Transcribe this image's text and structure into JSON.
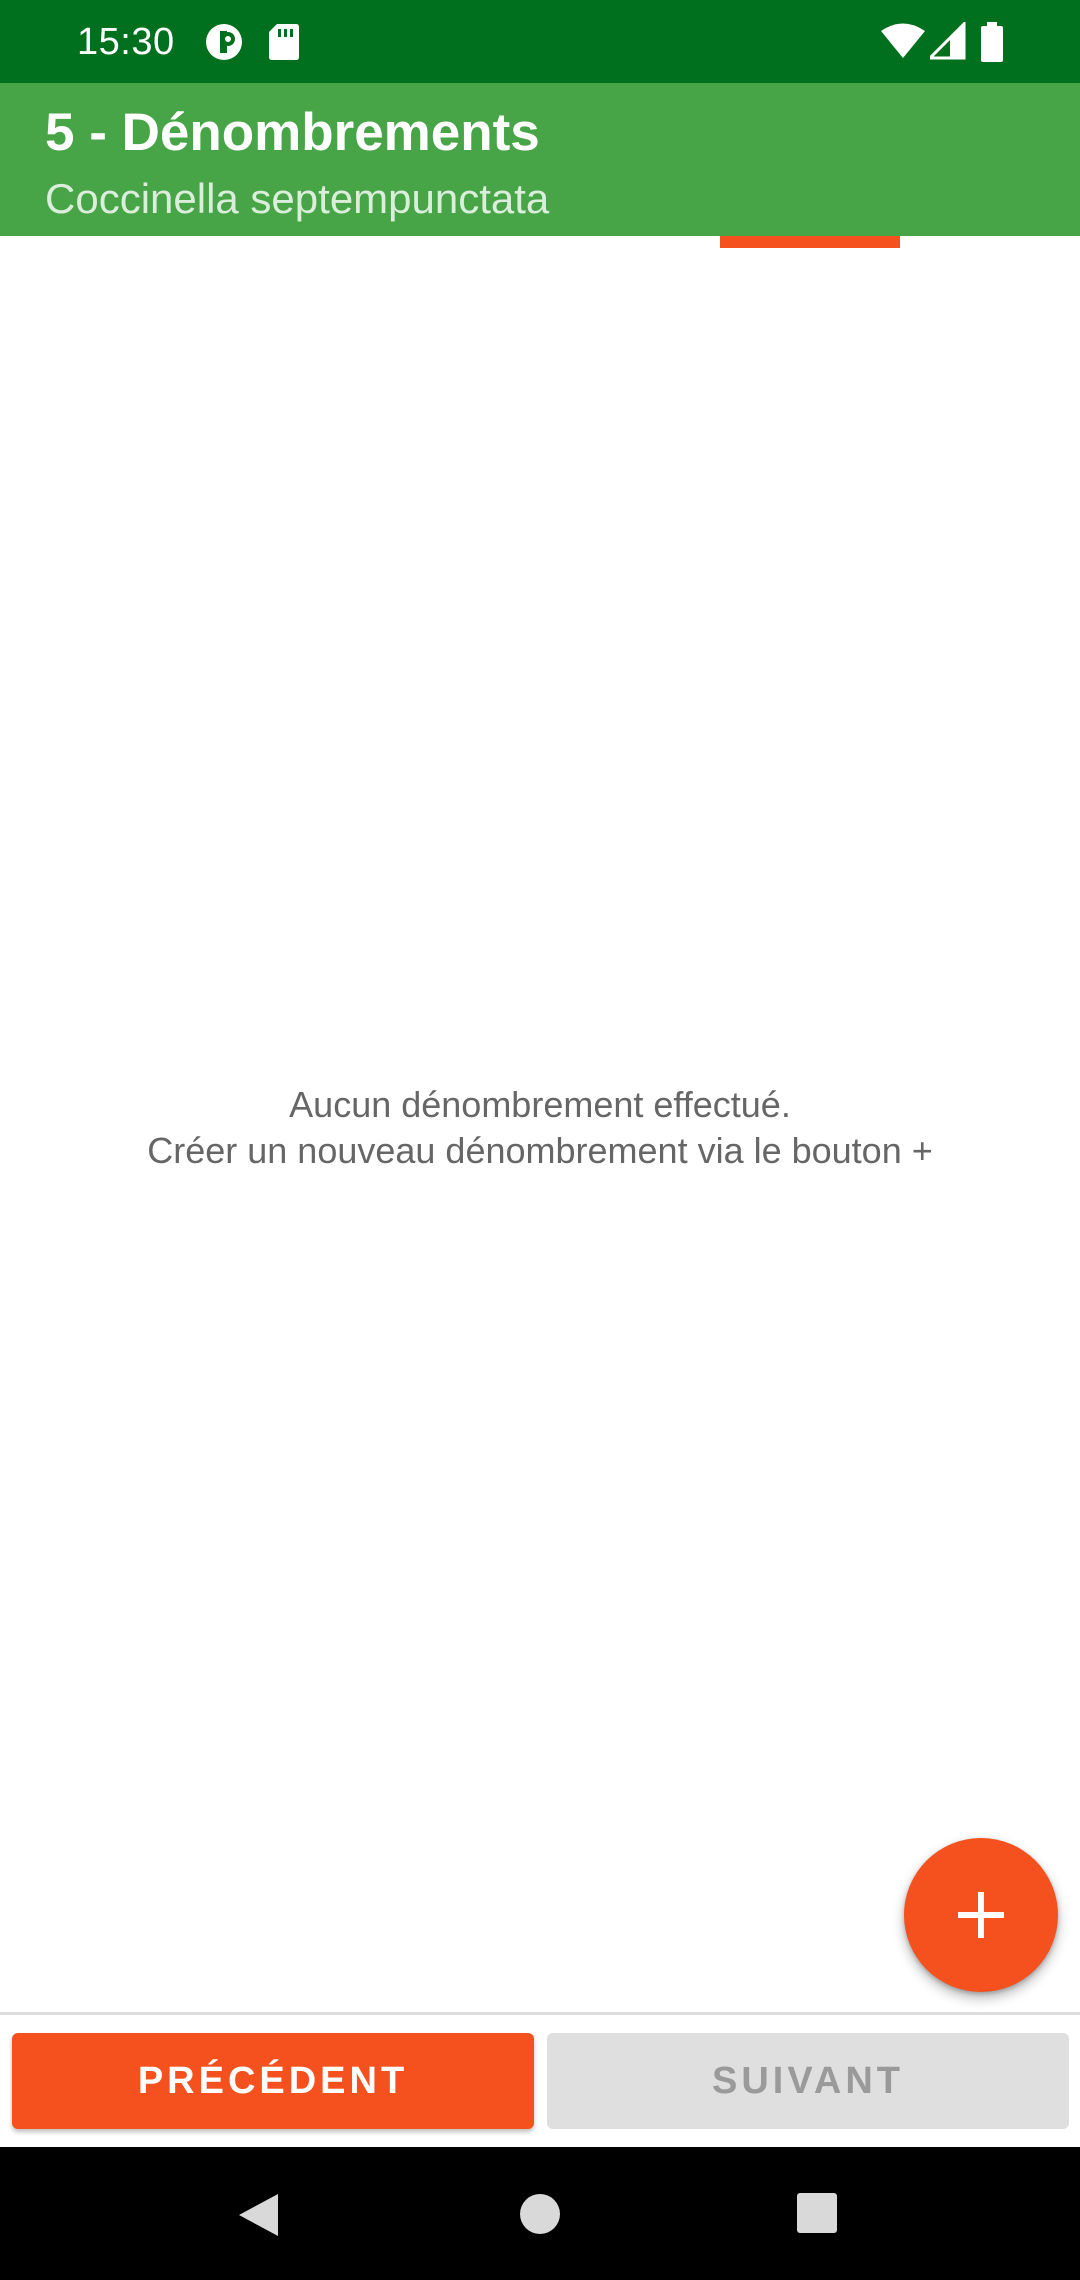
{
  "status_bar": {
    "time": "15:30",
    "icons": [
      "app-notification-icon",
      "sd-card-icon",
      "wifi-icon",
      "signal-icon",
      "battery-icon"
    ]
  },
  "app_bar": {
    "title": "5 - Dénombrements",
    "subtitle": "Coccinella septempunctata"
  },
  "content": {
    "empty_line1": "Aucun dénombrement effectué.",
    "empty_line2": "Créer un nouveau dénombrement via le bouton +"
  },
  "fab": {
    "icon": "plus-icon"
  },
  "buttons": {
    "previous": "PRÉCÉDENT",
    "next": "SUIVANT"
  },
  "nav_bar": {
    "icons": [
      "back-icon",
      "home-icon",
      "recents-icon"
    ]
  },
  "colors": {
    "status_bar": "#00701f",
    "app_bar": "#47a447",
    "accent": "#f4511e",
    "disabled_button": "#dfdfdf"
  }
}
